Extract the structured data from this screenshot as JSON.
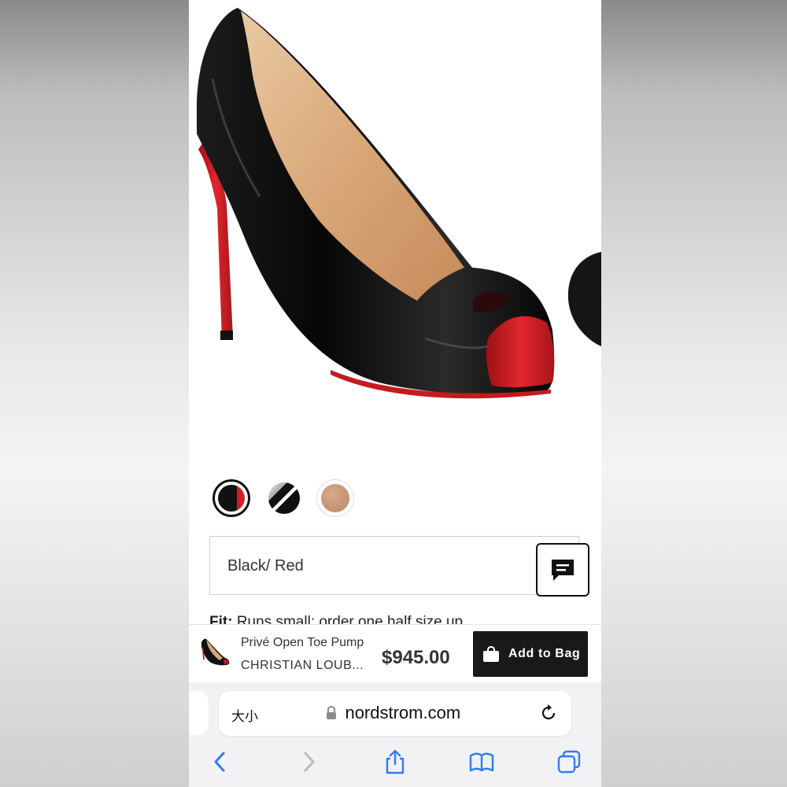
{
  "colors": {
    "accent_dark": "#191919",
    "ios_blue": "#2f7cf6",
    "sole_red": "#d41c24"
  },
  "product": {
    "image_alt_icon": "peep-toe-pump-image",
    "color_options": [
      {
        "name": "black-red-swatch",
        "selected": true
      },
      {
        "name": "black-patent-swatch",
        "selected": false
      },
      {
        "name": "nude-swatch",
        "selected": false
      }
    ],
    "selected_color": "Black/ Red",
    "fit_label": "Fit:",
    "fit_peek": "Runs small; order one half size up"
  },
  "sticky_bar": {
    "product_name": "Privé Open Toe Pump",
    "brand": "CHRISTIAN LOUB...",
    "price": "$945.00",
    "add_to_bag_label": "Add to Bag"
  },
  "browser": {
    "aa_label": "大小",
    "url": "nordstrom.com",
    "icons": [
      "back-icon",
      "forward-icon",
      "share-icon",
      "bookmarks-icon",
      "tabs-icon",
      "lock-icon",
      "reload-icon"
    ]
  }
}
